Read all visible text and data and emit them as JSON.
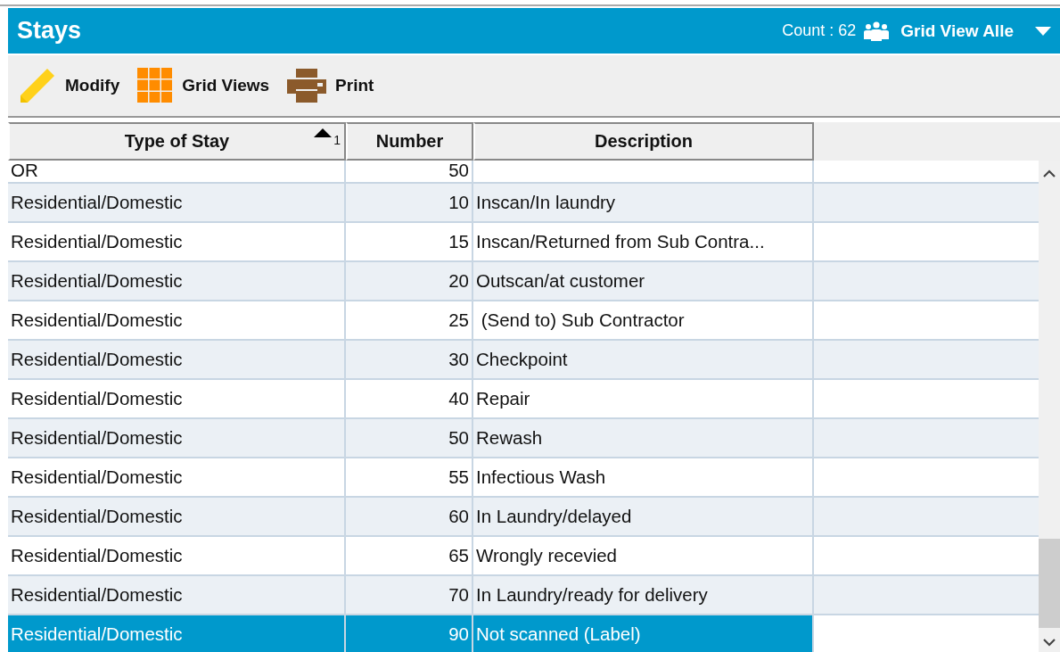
{
  "window": {
    "title": "Stays",
    "count": "Count : 62",
    "view": "Grid View Alle"
  },
  "toolbar": [
    {
      "kind": "pencil",
      "label": "Modify"
    },
    {
      "kind": "grid",
      "label": "Grid Views"
    },
    {
      "kind": "printer",
      "label": "Print"
    }
  ],
  "table": {
    "columns": [
      {
        "label": "Type of Stay",
        "sort_order": "1"
      },
      {
        "label": "Number"
      },
      {
        "label": "Description"
      }
    ],
    "rows": [
      {
        "cells": [
          "OR",
          "50",
          ""
        ],
        "selected": false
      },
      {
        "cells": [
          "Residential/Domestic",
          "10",
          "Inscan/In laundry"
        ],
        "selected": false
      },
      {
        "cells": [
          "Residential/Domestic",
          "15",
          "Inscan/Returned from Sub Contra..."
        ],
        "selected": false
      },
      {
        "cells": [
          "Residential/Domestic",
          "20",
          "Outscan/at customer"
        ],
        "selected": false
      },
      {
        "cells": [
          "Residential/Domestic",
          "25",
          " (Send to) Sub Contractor"
        ],
        "selected": false
      },
      {
        "cells": [
          "Residential/Domestic",
          "30",
          "Checkpoint"
        ],
        "selected": false
      },
      {
        "cells": [
          "Residential/Domestic",
          "40",
          "Repair"
        ],
        "selected": false
      },
      {
        "cells": [
          "Residential/Domestic",
          "50",
          "Rewash"
        ],
        "selected": false
      },
      {
        "cells": [
          "Residential/Domestic",
          "55",
          "Infectious Wash"
        ],
        "selected": false
      },
      {
        "cells": [
          "Residential/Domestic",
          "60",
          "In Laundry/delayed"
        ],
        "selected": false
      },
      {
        "cells": [
          "Residential/Domestic",
          "65",
          "Wrongly recevied"
        ],
        "selected": false
      },
      {
        "cells": [
          "Residential/Domestic",
          "70",
          "In Laundry/ready for delivery"
        ],
        "selected": false
      },
      {
        "cells": [
          "Residential/Domestic",
          "90",
          "Not scanned (Label)"
        ],
        "selected": true
      }
    ]
  }
}
